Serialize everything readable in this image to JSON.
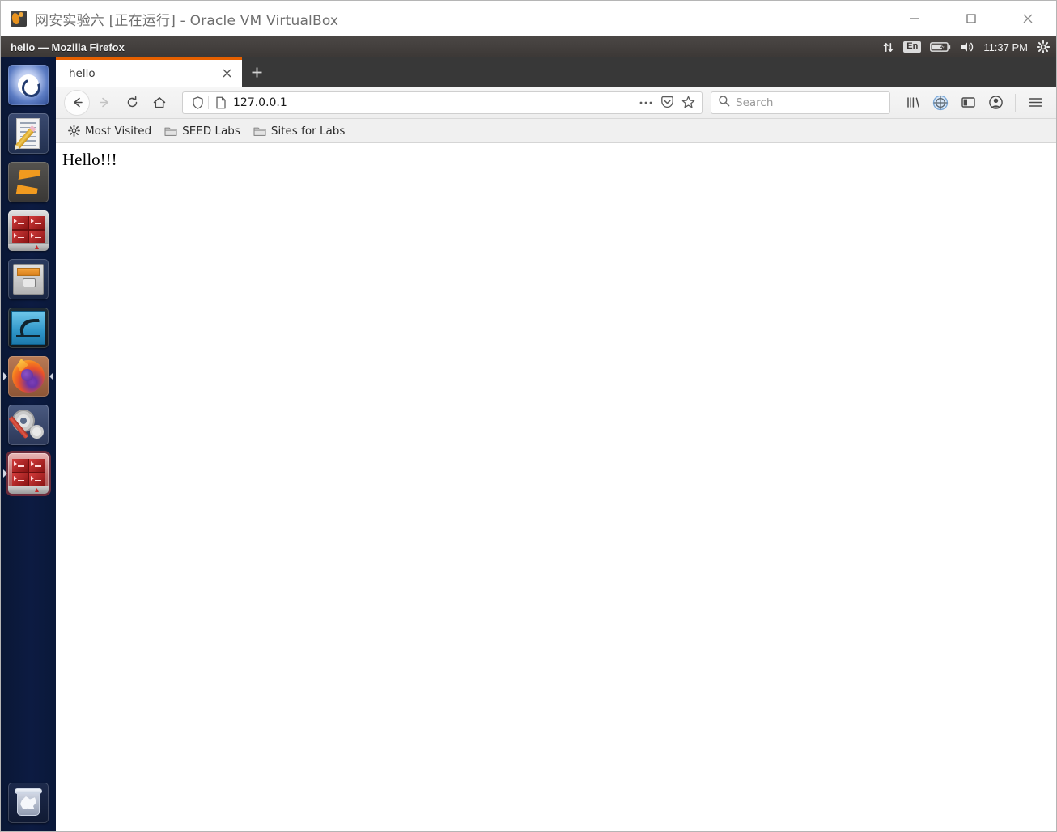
{
  "host_window": {
    "title": "网安实验六 [正在运行] - Oracle VM VirtualBox",
    "app_icon": "virtualbox-icon",
    "controls": {
      "minimize": "minimize-button",
      "maximize": "maximize-button",
      "close": "close-button"
    }
  },
  "unity_panel": {
    "window_title": "hello — Mozilla Firefox",
    "indicators": {
      "network": "network-arrows-icon",
      "keyboard_layout": "En",
      "battery": "battery-charging-icon",
      "volume": "volume-icon",
      "clock": "11:37 PM",
      "session": "gear-icon"
    }
  },
  "launcher": {
    "items": [
      {
        "name": "dash-home",
        "label": "Ubuntu Dash",
        "icon": "ubuntu-logo-icon",
        "running": false,
        "focused": false
      },
      {
        "name": "text-editor",
        "label": "Text Editor",
        "icon": "document-pencil-icon",
        "running": false,
        "focused": false
      },
      {
        "name": "sublime-text",
        "label": "Sublime Text",
        "icon": "sublime-s-icon",
        "running": false,
        "focused": false
      },
      {
        "name": "terminal",
        "label": "Terminal",
        "icon": "terminal-icon",
        "running": false,
        "focused": false
      },
      {
        "name": "files",
        "label": "Files",
        "icon": "file-cabinet-icon",
        "running": false,
        "focused": false
      },
      {
        "name": "wireshark",
        "label": "Wireshark",
        "icon": "wireshark-fin-icon",
        "running": false,
        "focused": false
      },
      {
        "name": "firefox",
        "label": "Firefox",
        "icon": "firefox-icon",
        "running": true,
        "focused": false
      },
      {
        "name": "system-settings",
        "label": "System Settings",
        "icon": "gear-wrench-icon",
        "running": false,
        "focused": false
      },
      {
        "name": "terminal-window",
        "label": "Terminal",
        "icon": "terminal-icon",
        "running": true,
        "focused": true
      }
    ],
    "trash": {
      "label": "Trash",
      "icon": "trash-bin-icon"
    }
  },
  "browser": {
    "tabs": [
      {
        "title": "hello",
        "active": true,
        "close_label": "Close tab"
      }
    ],
    "new_tab_label": "+",
    "nav": {
      "back": "back-arrow-icon",
      "forward": "forward-arrow-icon",
      "reload": "reload-icon",
      "home": "home-icon"
    },
    "urlbar": {
      "shield_icon": "tracking-protection-shield-icon",
      "page_icon": "page-info-icon",
      "value": "127.0.0.1",
      "page_actions_icon": "ellipsis-icon",
      "pocket_icon": "pocket-icon",
      "bookmark_icon": "star-icon"
    },
    "search": {
      "icon": "search-icon",
      "placeholder": "Search",
      "value": ""
    },
    "toolbar_right": {
      "library": "library-icon",
      "sync": "sync-circle-icon",
      "sidebar": "sidebar-toggle-icon",
      "account": "account-avatar-icon",
      "menu": "hamburger-menu-icon"
    },
    "bookmarks": [
      {
        "label": "Most Visited",
        "icon": "gear-icon"
      },
      {
        "label": "SEED Labs",
        "icon": "folder-icon"
      },
      {
        "label": "Sites for Labs",
        "icon": "folder-icon"
      }
    ]
  },
  "page": {
    "body_text": "Hello!!!"
  },
  "colors": {
    "firefox_accent": "#e66000",
    "launcher_bg": "#0c1b42",
    "panel_bg": "#3c3836",
    "tabstrip_bg": "#383838",
    "toolbar_bg": "#f0f0f0"
  }
}
